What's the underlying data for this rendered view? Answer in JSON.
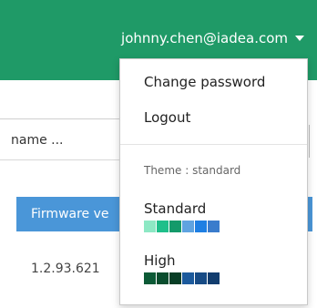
{
  "header": {
    "user_email": "johnny.chen@iadea.com",
    "bg_color": "#1f9a67"
  },
  "search": {
    "placeholder": "name ..."
  },
  "table": {
    "header_label": "Firmware ve",
    "rows": [
      {
        "firmware": "1.2.93.621"
      }
    ]
  },
  "user_menu": {
    "items": [
      {
        "label": "Change password"
      },
      {
        "label": "Logout"
      }
    ],
    "theme_label": "Theme : standard",
    "themes": [
      {
        "name": "Standard",
        "colors": [
          "#8de8c4",
          "#1fbf8a",
          "#149a6a",
          "#5fa3e0",
          "#1e7fe3",
          "#3a7ccc"
        ]
      },
      {
        "name": "High",
        "colors": [
          "#0c5a36",
          "#0a4d2e",
          "#093e26",
          "#1c5a9c",
          "#174b85",
          "#123d6e"
        ]
      }
    ]
  }
}
